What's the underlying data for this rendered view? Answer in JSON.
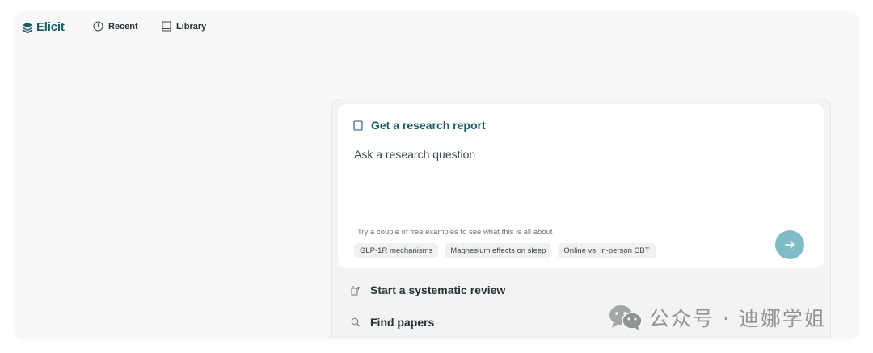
{
  "app": {
    "name": "Elicit"
  },
  "nav": {
    "items": [
      {
        "label": "Recent",
        "icon": "clock-icon"
      },
      {
        "label": "Library",
        "icon": "book-icon"
      }
    ]
  },
  "report_card": {
    "title": "Get a research report",
    "title_icon": "book-icon",
    "input_placeholder": "Ask a research question",
    "input_value": "",
    "examples_hint": "Try a couple of free examples to see what this is all about",
    "examples": [
      "GLP-1R mechanisms",
      "Magnesium effects on sleep",
      "Online vs. in-person CBT"
    ],
    "submit_icon": "arrow-right-icon"
  },
  "options": [
    {
      "label": "Start a systematic review",
      "icon": "review-icon"
    },
    {
      "label": "Find papers",
      "icon": "search-icon"
    }
  ],
  "watermark": {
    "text": "公众号 · 迪娜学姐",
    "icon": "wechat-icon"
  },
  "colors": {
    "brand": "#1b5a67",
    "submit": "#7fbcc6",
    "background": "#f7f8f7"
  }
}
